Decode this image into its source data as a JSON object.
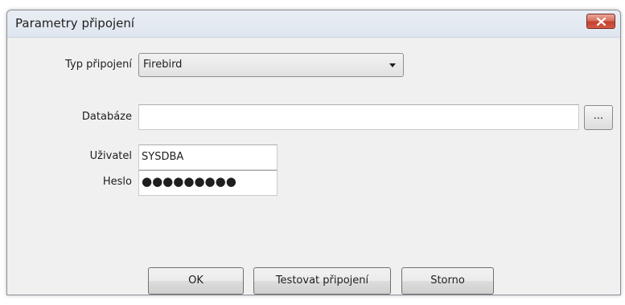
{
  "dialog": {
    "title": "Parametry připojení",
    "close_icon": "close-icon"
  },
  "form": {
    "connection_type_label": "Typ připojení",
    "connection_type_value": "Firebird",
    "database_label": "Databáze",
    "database_value": "",
    "browse_label": "...",
    "user_label": "Uživatel",
    "user_value": "SYSDBA",
    "password_label": "Heslo",
    "password_masked": "●●●●●●●●●"
  },
  "buttons": {
    "ok": "OK",
    "test": "Testovat připojení",
    "cancel": "Storno"
  },
  "colors": {
    "close_button": "#c4402b",
    "dialog_background": "#f0f0f0"
  }
}
